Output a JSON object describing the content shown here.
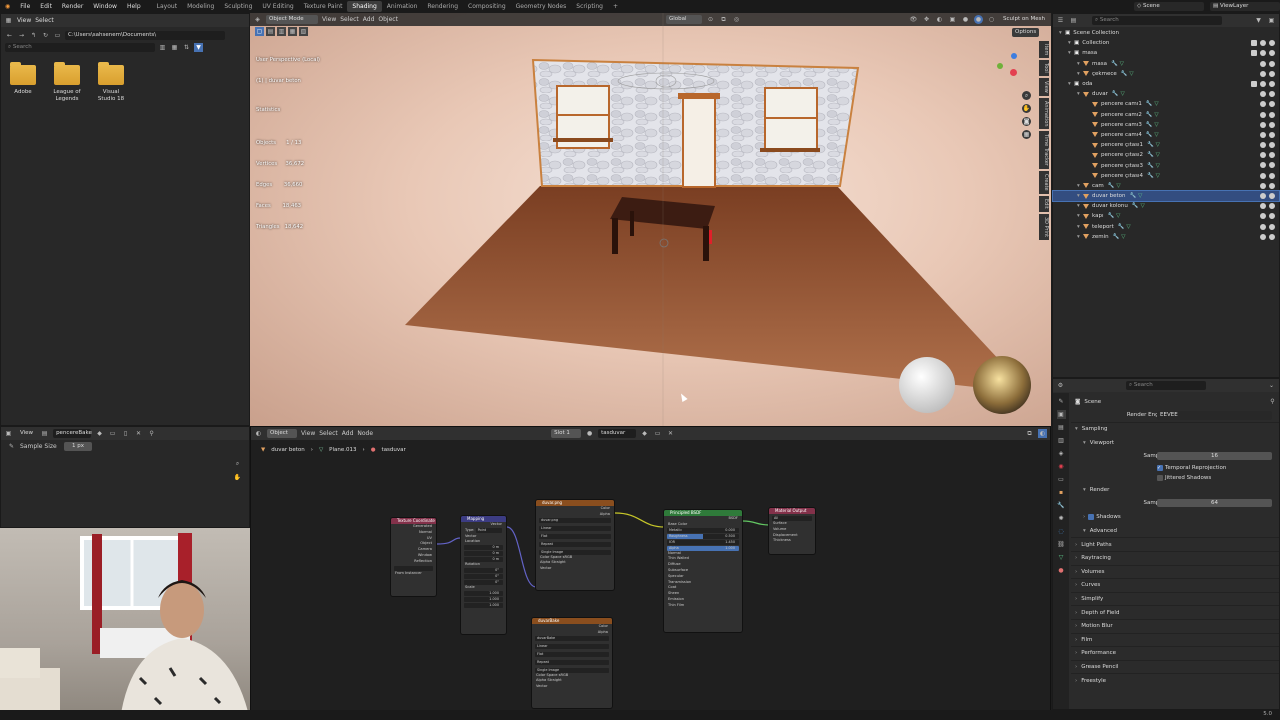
{
  "menu": {
    "items": [
      "File",
      "Edit",
      "Render",
      "Window",
      "Help"
    ],
    "workspaces": [
      "Layout",
      "Modeling",
      "Sculpting",
      "UV Editing",
      "Texture Paint",
      "Shading",
      "Animation",
      "Rendering",
      "Compositing",
      "Geometry Nodes",
      "Scripting",
      "+"
    ],
    "active_workspace": "Shading",
    "scene": "Scene",
    "view_layer": "ViewLayer"
  },
  "file_browser": {
    "view": "View",
    "select": "Select",
    "path": "C:\\Users\\sahsenem\\Documents\\",
    "search_placeholder": "Search",
    "folders": [
      "Adobe",
      "League of\nLegends",
      "Visual\nStudio 18"
    ]
  },
  "viewport": {
    "mode": "Object Mode",
    "menus": [
      "View",
      "Select",
      "Add",
      "Object"
    ],
    "orientation": "Global",
    "options": "Options",
    "sculpt_label": "Sculpt on Mesh",
    "overlay": [
      "User Perspective (Local)",
      "(1) | duvar beton",
      "Statistics",
      "Objects      1 / 13",
      "Vertices     36,672",
      "Edges       36,660",
      "Faces       18,463",
      "Triangles   18,642"
    ],
    "side_tabs": [
      "Item",
      "Tool",
      "View",
      "Animation",
      "Time Tracker",
      "Create",
      "Edit",
      "3D Print"
    ]
  },
  "image_editor": {
    "view": "View",
    "image": "pencereBake",
    "sample_label": "Sample Size",
    "sample_value": "1 px"
  },
  "node_editor": {
    "type": "Object",
    "menus": [
      "View",
      "Select",
      "Add",
      "Node"
    ],
    "slot": "Slot 1",
    "material": "tasduvar",
    "breadcrumb": [
      "duvar beton",
      "Plane.013",
      "tasduvar"
    ],
    "nodes": {
      "texcoord": {
        "title": "Texture Coordinate",
        "outputs": [
          "Generated",
          "Normal",
          "UV",
          "Object",
          "Camera",
          "Window",
          "Reflection"
        ],
        "from_instancer": "From Instancer"
      },
      "mapping": {
        "title": "Mapping",
        "output": "Vector",
        "type_label": "Type:",
        "type": "Point",
        "inputs": [
          "Vector",
          "Location",
          "Rotation",
          "Scale"
        ],
        "loc": [
          "0 m",
          "0 m",
          "0 m"
        ],
        "rot": [
          "0°",
          "0°",
          "0°"
        ],
        "scale": [
          "1.000",
          "1.000",
          "1.000"
        ]
      },
      "image1": {
        "title": "duvar.png",
        "outputs": [
          "Color",
          "Alpha"
        ],
        "image": "duvar.png",
        "settings": [
          "Linear",
          "Flat",
          "Repeat",
          "Single Image"
        ],
        "colorspace_label": "Color Space",
        "colorspace": "sRGB",
        "alpha_label": "Alpha",
        "alpha": "Straight",
        "vector": "Vector"
      },
      "image2": {
        "title": "duvarBake",
        "outputs": [
          "Color",
          "Alpha"
        ],
        "image": "duvarBake",
        "settings": [
          "Linear",
          "Flat",
          "Repeat",
          "Single Image"
        ],
        "colorspace_label": "Color Space",
        "colorspace": "sRGB",
        "alpha_label": "Alpha",
        "alpha": "Straight",
        "vector": "Vector"
      },
      "bsdf": {
        "title": "Principled BSDF",
        "output": "BSDF",
        "rows": [
          "Base Color",
          "Metallic",
          "Roughness",
          "IOR",
          "Alpha",
          "Normal"
        ],
        "values": [
          "",
          "0.000",
          "0.500",
          "1.450",
          "1.000",
          ""
        ],
        "weight": "Thin Walled",
        "panels": [
          "Diffuse",
          "Subsurface",
          "Specular",
          "Transmission",
          "Coat",
          "Sheen",
          "Emission",
          "Thin Film"
        ]
      },
      "output": {
        "title": "Material Output",
        "target": "All",
        "inputs": [
          "Surface",
          "Volume",
          "Displacement",
          "Thickness"
        ]
      }
    }
  },
  "outliner": {
    "search_placeholder": "Search",
    "rows": [
      {
        "label": "Scene Collection",
        "depth": 0,
        "sel": false
      },
      {
        "label": "Collection",
        "depth": 1,
        "sel": false
      },
      {
        "label": "masa",
        "depth": 1,
        "sel": false
      },
      {
        "label": "masa",
        "depth": 2,
        "sel": false
      },
      {
        "label": "çekmece",
        "depth": 2,
        "sel": false
      },
      {
        "label": "oda",
        "depth": 1,
        "sel": false
      },
      {
        "label": "duvar",
        "depth": 2,
        "sel": false
      },
      {
        "label": "pencere camı1",
        "depth": 3,
        "sel": false
      },
      {
        "label": "pencere camı2",
        "depth": 3,
        "sel": false
      },
      {
        "label": "pencere camı3",
        "depth": 3,
        "sel": false
      },
      {
        "label": "pencere camı4",
        "depth": 3,
        "sel": false
      },
      {
        "label": "pencere çıtası1",
        "depth": 3,
        "sel": false
      },
      {
        "label": "pencere çıtası2",
        "depth": 3,
        "sel": false
      },
      {
        "label": "pencere çıtası3",
        "depth": 3,
        "sel": false
      },
      {
        "label": "pencere çıtası4",
        "depth": 3,
        "sel": false
      },
      {
        "label": "cam",
        "depth": 2,
        "sel": false
      },
      {
        "label": "duvar beton",
        "depth": 2,
        "sel": true
      },
      {
        "label": "duvar kolonu",
        "depth": 2,
        "sel": false
      },
      {
        "label": "kapı",
        "depth": 2,
        "sel": false
      },
      {
        "label": "teleport",
        "depth": 2,
        "sel": false
      },
      {
        "label": "zemin",
        "depth": 2,
        "sel": false
      }
    ]
  },
  "properties": {
    "search_placeholder": "Search",
    "scene": "Scene",
    "engine_label": "Render Engine",
    "engine": "EEVEE",
    "rows": [
      {
        "label": "Sampling",
        "type": "section"
      },
      {
        "label": "Viewport",
        "type": "sub"
      },
      {
        "label": "Samples",
        "type": "slider",
        "value": "16"
      },
      {
        "label": "Temporal Reprojection",
        "type": "check"
      },
      {
        "label": "Jittered Shadows",
        "type": "check2"
      },
      {
        "label": "Render",
        "type": "sub"
      },
      {
        "label": "Samples",
        "type": "slider",
        "value": "64"
      },
      {
        "label": "Shadows",
        "type": "checksub"
      },
      {
        "label": "Advanced",
        "type": "sub"
      },
      {
        "label": "Light Paths",
        "type": "section"
      },
      {
        "label": "Raytracing",
        "type": "section"
      },
      {
        "label": "Volumes",
        "type": "section"
      },
      {
        "label": "Curves",
        "type": "section"
      },
      {
        "label": "Simplify",
        "type": "section"
      },
      {
        "label": "Depth of Field",
        "type": "section"
      },
      {
        "label": "Motion Blur",
        "type": "section"
      },
      {
        "label": "Film",
        "type": "section"
      },
      {
        "label": "Performance",
        "type": "section"
      },
      {
        "label": "Grease Pencil",
        "type": "section"
      },
      {
        "label": "Freestyle",
        "type": "section"
      }
    ]
  },
  "status": {
    "version": "5.0"
  }
}
